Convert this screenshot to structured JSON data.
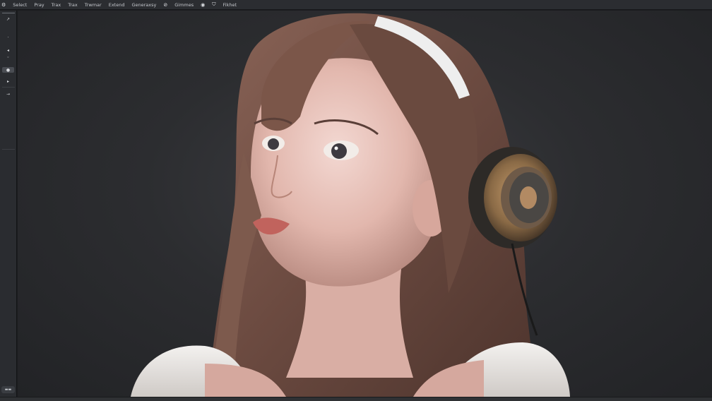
{
  "menu": {
    "items": [
      "Select",
      "Pray",
      "Trax",
      "Trax",
      "Trwmar",
      "Extend",
      "Generaxsy",
      "Gimmes",
      "Fikhet"
    ],
    "icons": [
      "app-icon",
      "eye-icon",
      "shield-icon"
    ]
  },
  "toolbar": {
    "tools": [
      "lasso-tool",
      "brush-tool",
      "dot-tool",
      "eye-tool",
      "selected-tool",
      "arrow-tool"
    ],
    "bottom_label": ""
  },
  "canvas": {
    "content": "portrait-of-girl-with-headphones",
    "background_color": "#2c2d30"
  }
}
